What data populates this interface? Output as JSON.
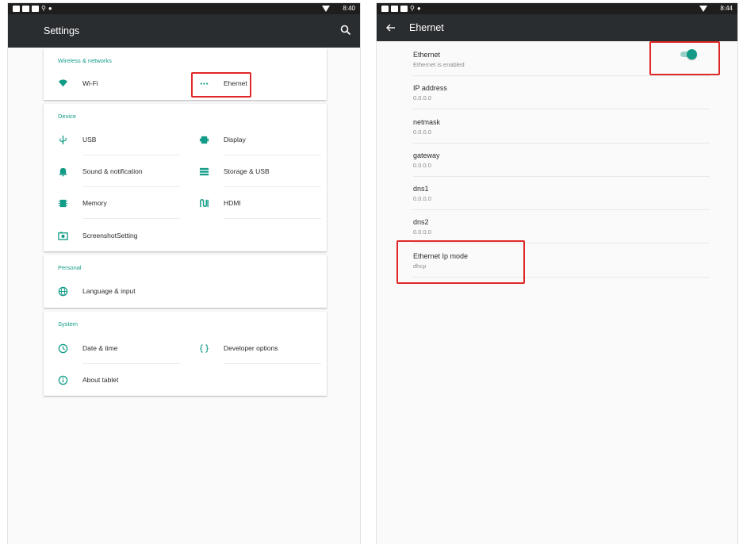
{
  "colors": {
    "accent": "#129c87",
    "appbar": "#2a2d30",
    "statusbar": "#1e1e1e",
    "highlight": "#e02828"
  },
  "left": {
    "status_time": "8:40",
    "title": "Settings",
    "sections": [
      {
        "title": "Wireless & networks",
        "items": [
          {
            "label": "Wi-Fi",
            "icon": "wifi-icon"
          },
          {
            "label": "Ehernet",
            "icon": "more-dots-icon"
          }
        ]
      },
      {
        "title": "Device",
        "items": [
          {
            "label": "USB",
            "icon": "usb-icon"
          },
          {
            "label": "Display",
            "icon": "display-icon"
          },
          {
            "label": "Sound & notification",
            "icon": "bell-icon"
          },
          {
            "label": "Storage & USB",
            "icon": "storage-icon"
          },
          {
            "label": "Memory",
            "icon": "memory-icon"
          },
          {
            "label": "HDMI",
            "icon": "hdmi-icon"
          },
          {
            "label": "ScreenshotSetting",
            "icon": "screenshot-icon"
          }
        ]
      },
      {
        "title": "Personal",
        "items": [
          {
            "label": "Language & input",
            "icon": "globe-icon"
          }
        ]
      },
      {
        "title": "System",
        "items": [
          {
            "label": "Date & time",
            "icon": "clock-icon"
          },
          {
            "label": "Developer options",
            "icon": "braces-icon"
          },
          {
            "label": "About tablet",
            "icon": "info-icon"
          }
        ]
      }
    ]
  },
  "right": {
    "status_time": "8:44",
    "title": "Ehernet",
    "prefs": [
      {
        "title": "Ethernet",
        "subtitle": "Ethernet is enabled"
      },
      {
        "title": "IP address",
        "subtitle": "0.0.0.0"
      },
      {
        "title": "netmask",
        "subtitle": "0.0.0.0"
      },
      {
        "title": "gateway",
        "subtitle": "0.0.0.0"
      },
      {
        "title": "dns1",
        "subtitle": "0.0.0.0"
      },
      {
        "title": "dns2",
        "subtitle": "0.0.0.0"
      },
      {
        "title": "Ethernet Ip mode",
        "subtitle": "dhcp"
      }
    ],
    "ethernet_enabled": true
  }
}
